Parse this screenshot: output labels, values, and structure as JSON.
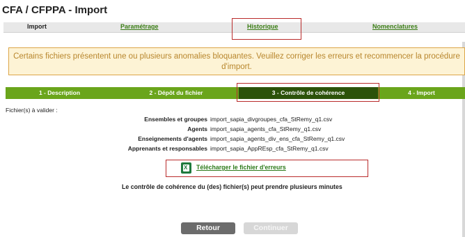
{
  "page": {
    "title": "CFA / CFPPA - Import"
  },
  "main_tabs": [
    {
      "label": "Import",
      "active": true
    },
    {
      "label": "Paramétrage",
      "active": false
    },
    {
      "label": "Historique",
      "active": false
    },
    {
      "label": "Nomenclatures",
      "active": false
    }
  ],
  "alert": {
    "message": "Certains fichiers présentent une ou plusieurs anomalies bloquantes. Veuillez corriger les erreurs et recommencer la procédure d'import."
  },
  "wizard": {
    "steps": [
      {
        "label": "1 - Description",
        "active": false
      },
      {
        "label": "2 - Dépôt du fichier",
        "active": false
      },
      {
        "label": "3 - Contrôle de cohérence",
        "active": true
      },
      {
        "label": "4 - Import",
        "active": false
      }
    ]
  },
  "files": {
    "label": "Fichier(s) à valider :",
    "rows": [
      {
        "key": "Ensembles et groupes",
        "value": "import_sapia_divgroupes_cfa_StRemy_q1.csv"
      },
      {
        "key": "Agents",
        "value": "import_sapia_agents_cfa_StRemy_q1.csv"
      },
      {
        "key": "Enseignements d'agents",
        "value": "import_sapia_agents_div_ens_cfa_StRemy_q1.csv"
      },
      {
        "key": "Apprenants et responsables",
        "value": "import_sapia_AppREsp_cfa_StRemy_q1.csv"
      }
    ]
  },
  "download": {
    "icon": "excel-file-icon",
    "label": "Télécharger le fichier d'erreurs"
  },
  "info": "Le contrôle de cohérence du (des) fichier(s) peut prendre plusieurs minutes",
  "buttons": {
    "back": "Retour",
    "next": "Continuer"
  },
  "colors": {
    "link_green": "#3a7d14",
    "wizard_green": "#6aa51b",
    "wizard_active": "#2c520a",
    "alert_bg": "#fdf3d5",
    "alert_text": "#b8862d",
    "highlight_red": "#b92b2b"
  }
}
